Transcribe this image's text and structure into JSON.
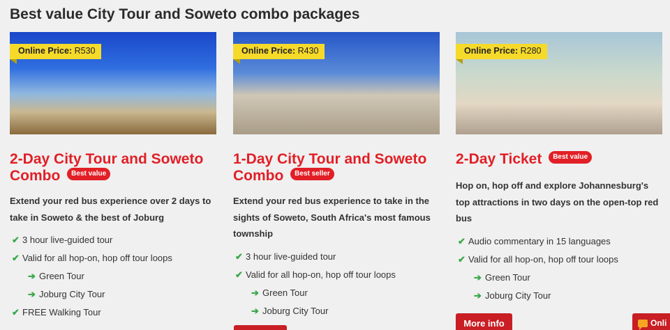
{
  "section": {
    "title": "Best value City Tour and Soweto combo packages"
  },
  "cards": [
    {
      "price_label": "Online Price:",
      "price_value": "R530",
      "title": "2-Day City Tour and Soweto Combo",
      "badge": "Best value",
      "description": "Extend your red bus experience over 2 days to take in Soweto & the best of Joburg",
      "features": [
        {
          "text": "3 hour live-guided tour",
          "icon": "check-icon"
        },
        {
          "text": "Valid for all hop-on, hop off tour loops",
          "icon": "check-icon"
        },
        {
          "text": "Green Tour",
          "icon": "arrow-icon",
          "sub": true
        },
        {
          "text": "Joburg City Tour",
          "icon": "arrow-icon",
          "sub": true
        },
        {
          "text": "FREE Walking Tour",
          "icon": "check-icon"
        }
      ]
    },
    {
      "price_label": "Online Price:",
      "price_value": "R430",
      "title": "1-Day City Tour and Soweto Combo",
      "badge": "Best seller",
      "description": "Extend your red bus experience to take in the sights of Soweto, South Africa's most famous township",
      "features": [
        {
          "text": "3 hour live-guided tour",
          "icon": "check-icon"
        },
        {
          "text": "Valid for all hop-on, hop off tour loops",
          "icon": "check-icon"
        },
        {
          "text": "Green Tour",
          "icon": "arrow-icon",
          "sub": true
        },
        {
          "text": "Joburg City Tour",
          "icon": "arrow-icon",
          "sub": true
        }
      ]
    },
    {
      "price_label": "Online Price:",
      "price_value": "R280",
      "title": "2-Day Ticket",
      "badge": "Best value",
      "description": "Hop on, hop off and explore Johannesburg's top attractions in two days on the open-top red bus",
      "features": [
        {
          "text": "Audio commentary in 15 languages",
          "icon": "check-icon"
        },
        {
          "text": "Valid for all hop-on, hop off tour loops",
          "icon": "check-icon"
        },
        {
          "text": "Green Tour",
          "icon": "arrow-icon",
          "sub": true
        },
        {
          "text": "Joburg City Tour",
          "icon": "arrow-icon",
          "sub": true
        }
      ],
      "button_label": "More info"
    }
  ],
  "chat": {
    "label": "Onli"
  },
  "colors": {
    "accent": "#e21f26",
    "price_tag": "#f6da2a",
    "check": "#3aa84a"
  }
}
